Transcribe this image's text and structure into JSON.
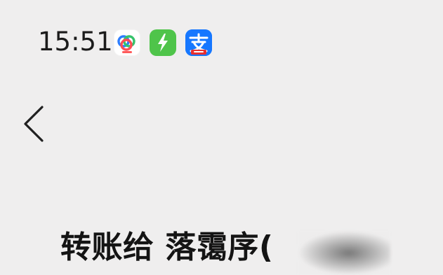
{
  "status_bar": {
    "time": "15:51",
    "notification_icons": [
      "baidu-netdisk-icon",
      "lightning-app-icon",
      "alipay-icon"
    ]
  },
  "nav": {
    "back_icon": "chevron-left-icon"
  },
  "transfer": {
    "title": "转账给 落霭序("
  },
  "colors": {
    "background": "#efeeee",
    "baidu_blue": "#2d7dff",
    "baidu_red": "#ff4d55",
    "baidu_green": "#36c36b",
    "bolt_green": "#4fc44a",
    "alipay_blue": "#1677ff",
    "alipay_red": "#e82f2f"
  }
}
